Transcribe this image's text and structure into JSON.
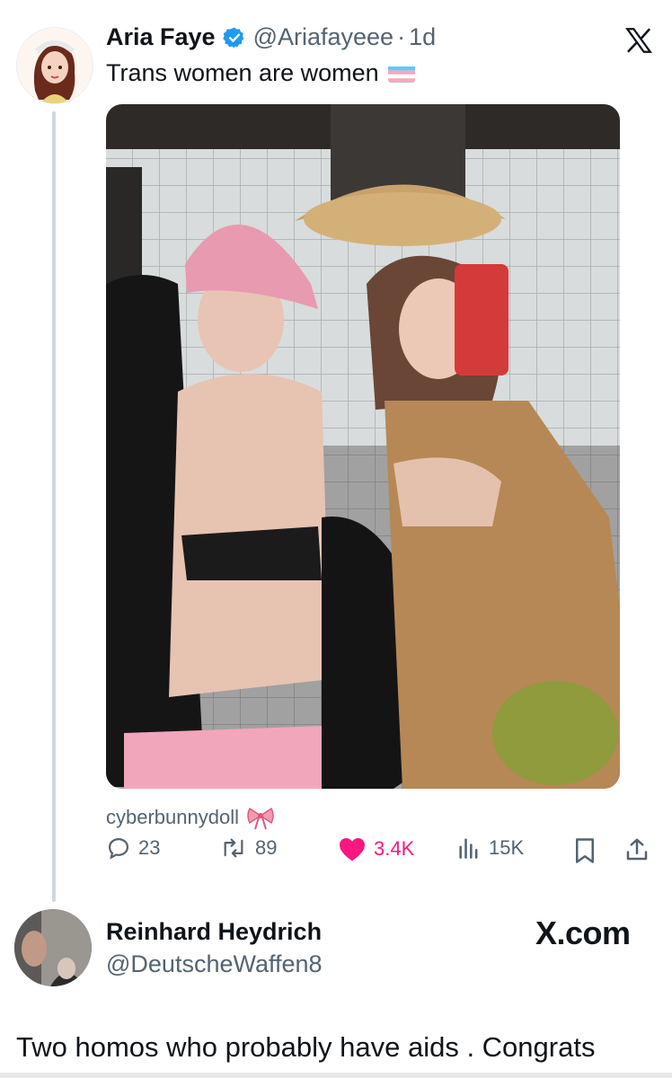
{
  "tweet": {
    "author_name": "Aria Faye",
    "author_handle": "@Ariafayeee",
    "separator": "·",
    "time": "1d",
    "text": "Trans women are women",
    "text_flag_icon": "trans-flag-icon",
    "caption": "cyberbunnydoll",
    "caption_icon": "ribbon-bow-icon",
    "stats": {
      "replies": "23",
      "retweets": "89",
      "likes": "3.4K",
      "views": "15K"
    },
    "colors": {
      "like": "#f91880",
      "verified": "#1d9bf0",
      "secondary": "#536471"
    }
  },
  "reply": {
    "author_name": "Reinhard Heydrich",
    "author_handle": "@DeutscheWaffen8",
    "text": "Two homos who probably have aids . Congrats"
  },
  "watermark": "X.com",
  "icons": {
    "x_logo": "x-logo-icon",
    "verified": "verified-badge-icon",
    "reply": "reply-icon",
    "retweet": "retweet-icon",
    "like": "heart-icon",
    "views": "views-icon",
    "bookmark": "bookmark-icon",
    "share": "share-icon"
  }
}
